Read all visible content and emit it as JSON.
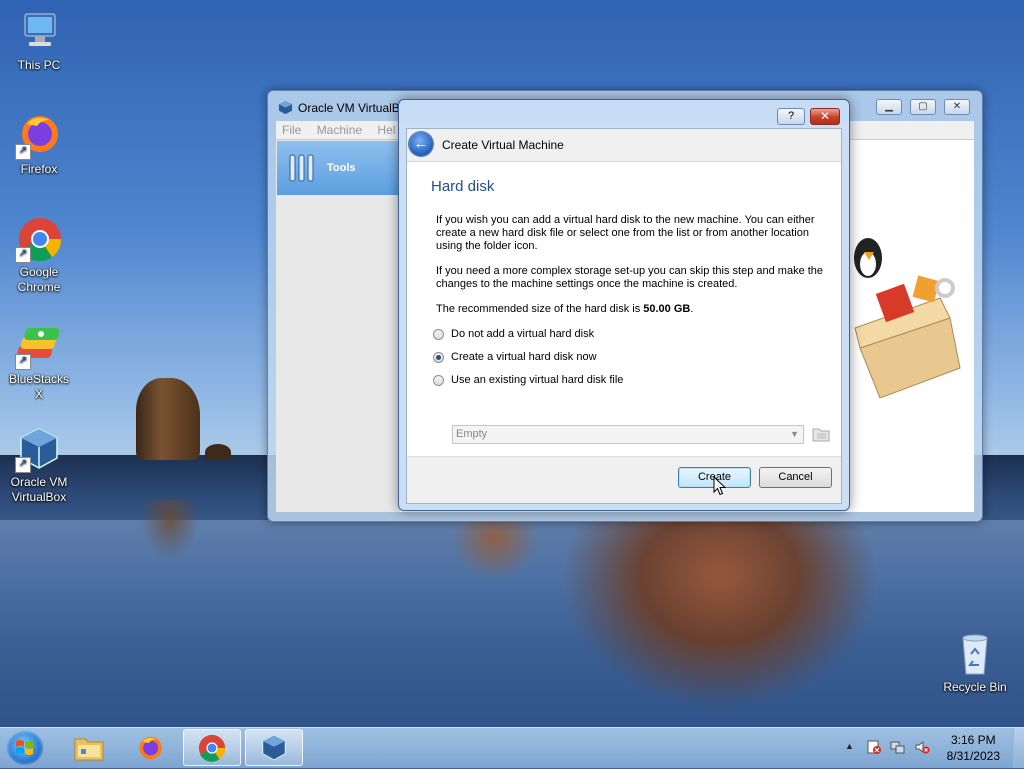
{
  "desktop": {
    "icons": [
      {
        "label": "This PC",
        "icon": "computer-icon"
      },
      {
        "label": "Firefox",
        "icon": "firefox-icon"
      },
      {
        "label": "Google Chrome",
        "icon": "chrome-icon"
      },
      {
        "label": "BlueStacks X",
        "icon": "bluestacks-icon"
      },
      {
        "label": "Oracle VM VirtualBox",
        "icon": "virtualbox-icon"
      },
      {
        "label": "Recycle Bin",
        "icon": "recycle-bin-icon"
      }
    ]
  },
  "vbox_window": {
    "title": "Oracle VM VirtualB",
    "menu": [
      "File",
      "Machine",
      "Hel"
    ],
    "tools_label": "Tools"
  },
  "dialog": {
    "help_label": "?",
    "close_label": "✕",
    "header_title": "Create Virtual Machine",
    "page_title": "Hard disk",
    "para1": "If you wish you can add a virtual hard disk to the new machine. You can either create a new hard disk file or select one from the list or from another location using the folder icon.",
    "para2": "If you need a more complex storage set-up you can skip this step and make the changes to the machine settings once the machine is created.",
    "recommended_prefix": "The recommended size of the hard disk is ",
    "recommended_size": "50.00 GB",
    "recommended_suffix": ".",
    "options": [
      {
        "label": "Do not add a virtual hard disk",
        "checked": false
      },
      {
        "label": "Create a virtual hard disk now",
        "checked": true
      },
      {
        "label": "Use an existing virtual hard disk file",
        "checked": false
      }
    ],
    "disk_select_value": "Empty",
    "create_label": "Create",
    "cancel_label": "Cancel"
  },
  "taskbar": {
    "clock_time": "3:16 PM",
    "clock_date": "8/31/2023"
  }
}
